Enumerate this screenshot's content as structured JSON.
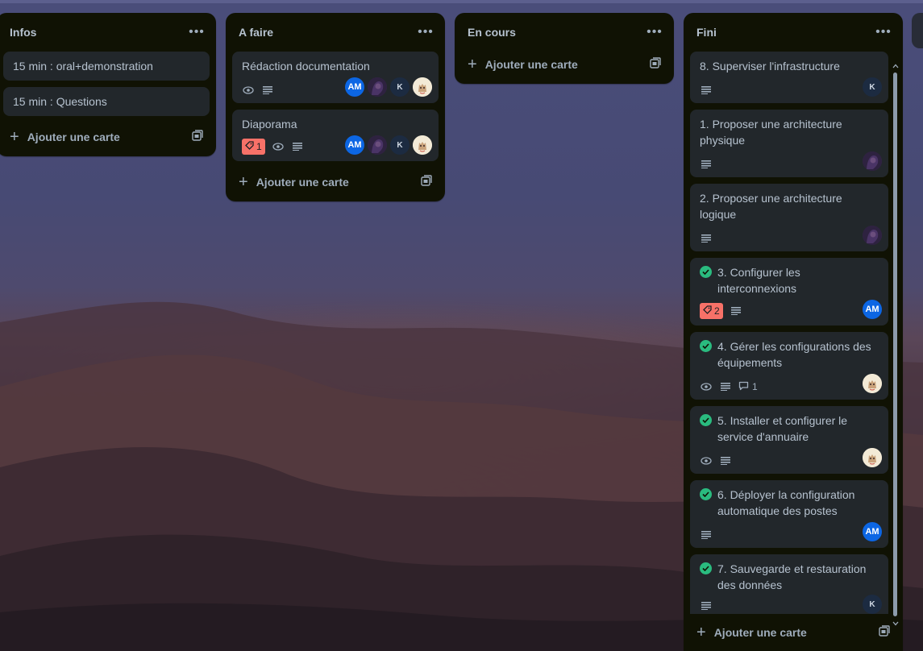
{
  "lists": [
    {
      "title": "Infos",
      "add_label": "Ajouter une carte",
      "cards": [
        {
          "title": "15 min : oral+demonstration"
        },
        {
          "title": "15 min : Questions"
        }
      ]
    },
    {
      "title": "A faire",
      "add_label": "Ajouter une carte",
      "cards": [
        {
          "title": "Rédaction documentation",
          "members": [
            "AM",
            "hair",
            "K",
            "cat"
          ]
        },
        {
          "title": "Diaporama",
          "label_count": "1",
          "members": [
            "AM",
            "hair",
            "K",
            "cat"
          ]
        }
      ]
    },
    {
      "title": "En cours",
      "add_label": "Ajouter une carte",
      "cards": []
    },
    {
      "title": "Fini",
      "add_label": "Ajouter une carte",
      "cards": [
        {
          "title": "8. Superviser l'infrastructure",
          "avatar_text": "K"
        },
        {
          "title": "1. Proposer une architecture physique"
        },
        {
          "title": "2. Proposer une architecture logique"
        },
        {
          "title": "3. Configurer les interconnexions",
          "label_count": "2",
          "avatar_text": "AM"
        },
        {
          "title": "4. Gérer les configurations des équipements",
          "comment_count": "1"
        },
        {
          "title": "5. Installer et configurer le service d'annuaire"
        },
        {
          "title": "6. Déployer la configuration automatique des postes",
          "avatar_text": "AM"
        },
        {
          "title": "7. Sauvegarde et restauration des données",
          "avatar_text": "K"
        }
      ]
    }
  ],
  "avatar_initials": {
    "am": "AM",
    "k": "K"
  },
  "icons": {
    "menu": "more-dots-icon",
    "watch": "eye-icon",
    "description": "description-lines-icon",
    "label": "tag-icon",
    "comment": "comment-icon",
    "template": "card-template-icon",
    "complete": "check-circle-icon"
  },
  "colors": {
    "list_bg": "#101204",
    "card_bg": "#22272b",
    "accent_blue": "#0c66e4",
    "label_red": "#f87168",
    "done_green": "#2abb7f"
  }
}
